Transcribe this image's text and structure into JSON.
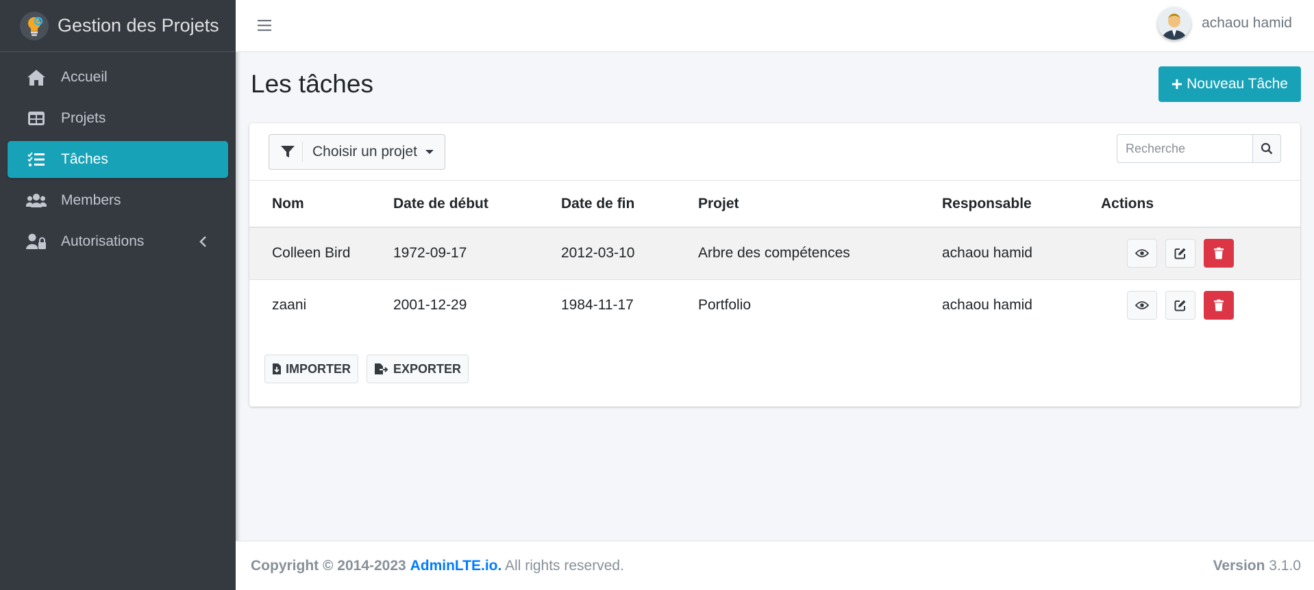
{
  "brand": {
    "name": "Gestion des Projets"
  },
  "sidebar": {
    "items": [
      {
        "label": "Accueil",
        "icon": "home-icon"
      },
      {
        "label": "Projets",
        "icon": "table-icon"
      },
      {
        "label": "Tâches",
        "icon": "tasks-icon",
        "active": true
      },
      {
        "label": "Members",
        "icon": "users-icon"
      },
      {
        "label": "Autorisations",
        "icon": "user-lock-icon"
      }
    ]
  },
  "topbar": {
    "user_name": "achaou hamid"
  },
  "page": {
    "title": "Les tâches",
    "new_button": "Nouveau Tâche"
  },
  "filter": {
    "label": "Choisir un projet"
  },
  "search": {
    "placeholder": "Recherche"
  },
  "table": {
    "headers": [
      "Nom",
      "Date de début",
      "Date de fin",
      "Projet",
      "Responsable",
      "Actions"
    ],
    "rows": [
      [
        "Colleen Bird",
        "1972-09-17",
        "2012-03-10",
        "Arbre des compétences",
        "achaou hamid"
      ],
      [
        "zaani",
        "2001-12-29",
        "1984-11-17",
        "Portfolio",
        "achaou hamid"
      ]
    ]
  },
  "card_footer": {
    "import": "IMPORTER",
    "export": "EXPORTER"
  },
  "footer": {
    "copyright": "Copyright © 2014-2023",
    "link": "AdminLTE.io.",
    "rights": "All rights reserved.",
    "version_label": "Version",
    "version": "3.1.0"
  },
  "colors": {
    "accent": "#17a2b8",
    "sidebar": "#343a40",
    "danger": "#dc3545",
    "link": "#007bff"
  }
}
